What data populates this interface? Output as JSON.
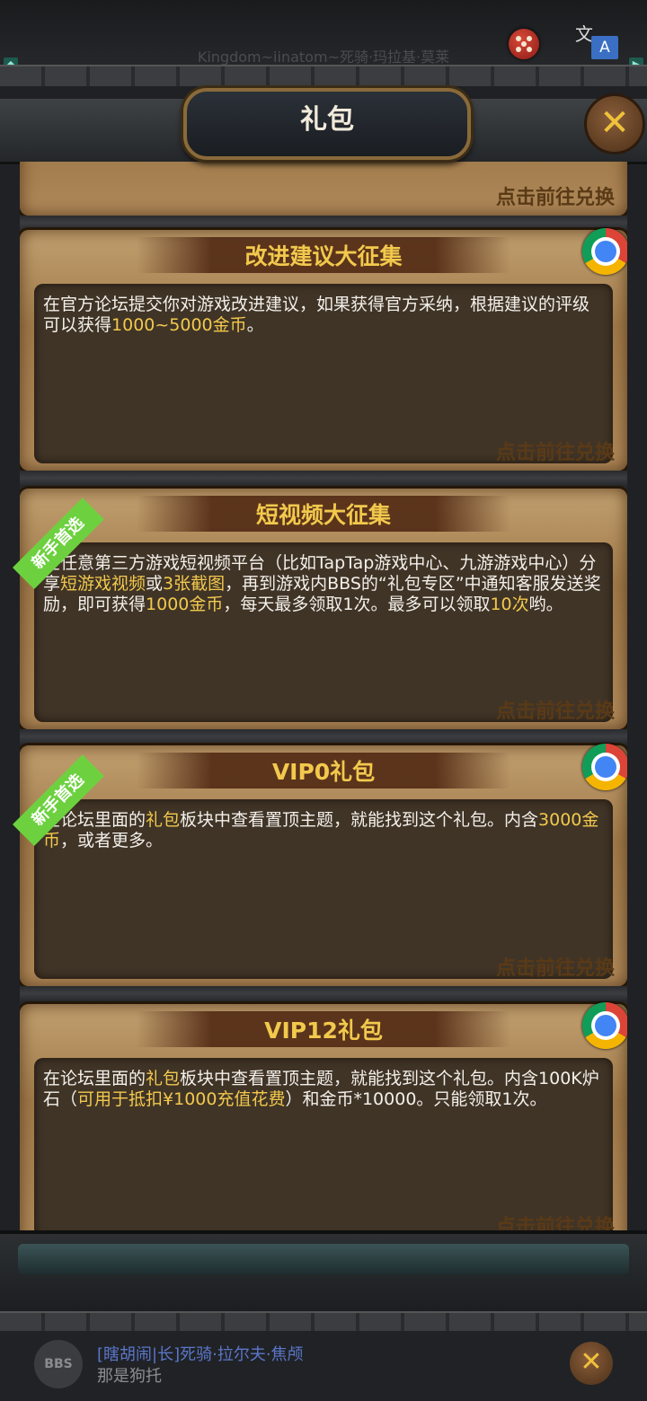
{
  "status": {
    "ticker": "Kingdom~iinatom~死骑·玛拉基·莫莱"
  },
  "header": {
    "title": "礼包",
    "close_label": "✕"
  },
  "redeem_label": "点击前往兑换",
  "badge_label": "新手首选",
  "cards": [
    {
      "title": "改进建议大征集",
      "desc_parts": [
        {
          "text": "在官方论坛提交你对游戏改进建议，如果获得官方采纳，根据建议的评级可以获得",
          "hl": false
        },
        {
          "text": "1000~5000金币",
          "hl": true
        },
        {
          "text": "。",
          "hl": false
        }
      ]
    },
    {
      "title": "短视频大征集",
      "desc_parts": [
        {
          "text": "在任意第三方游戏短视频平台（比如TapTap游戏中心、九游游戏中心）分享",
          "hl": false
        },
        {
          "text": "短游戏视频",
          "hl": true
        },
        {
          "text": "或",
          "hl": false
        },
        {
          "text": "3张截图",
          "hl": true
        },
        {
          "text": "，再到游戏内BBS的“礼包专区”中通知客服发送奖励，即可获得",
          "hl": false
        },
        {
          "text": "1000金币",
          "hl": true
        },
        {
          "text": "，每天最多领取1次。最多可以领取",
          "hl": false
        },
        {
          "text": "10次",
          "hl": true
        },
        {
          "text": "哟。",
          "hl": false
        }
      ]
    },
    {
      "title": "VIP0礼包",
      "desc_parts": [
        {
          "text": "在论坛里面的",
          "hl": false
        },
        {
          "text": "礼包",
          "hl": true
        },
        {
          "text": "板块中查看置顶主题，就能找到这个礼包。内含",
          "hl": false
        },
        {
          "text": "3000金币",
          "hl": true
        },
        {
          "text": "，或者更多。",
          "hl": false
        }
      ]
    },
    {
      "title": "VIP12礼包",
      "desc_parts": [
        {
          "text": "在论坛里面的",
          "hl": false
        },
        {
          "text": "礼包",
          "hl": true
        },
        {
          "text": "板块中查看置顶主题，就能找到这个礼包。内含100K炉石（",
          "hl": false
        },
        {
          "text": "可用于抵扣¥1000充值花费",
          "hl": true
        },
        {
          "text": "）和金币*10000。只能领取1次。",
          "hl": false
        }
      ]
    }
  ],
  "chat": {
    "bbs_label": "BBS",
    "name": "[瞎胡闹|长]死骑·拉尔夫·焦颅",
    "message": "那是狗托",
    "close_label": "✕"
  },
  "colors": {
    "highlight": "#f2c94c",
    "badge_green": "#6dd13f"
  }
}
